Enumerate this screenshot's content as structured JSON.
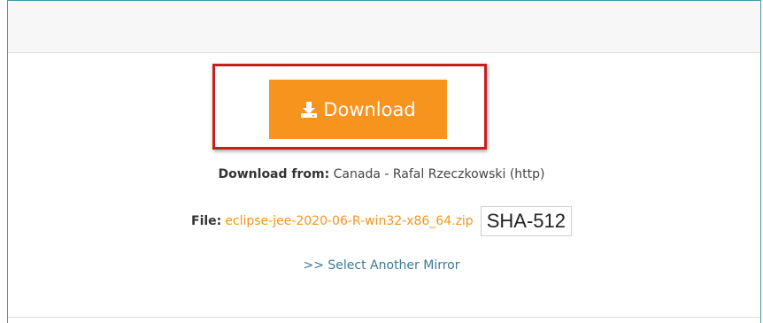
{
  "download_button": {
    "label": "Download",
    "icon": "download-icon",
    "color": "#f7941d"
  },
  "download_from": {
    "label": "Download from:",
    "value": "Canada - Rafal Rzeczkowski (http)"
  },
  "file": {
    "label": "File:",
    "name": "eclipse-jee-2020-06-R-win32-x86_64.zip",
    "checksum_label": "SHA-512"
  },
  "mirror_link": {
    "label": ">> Select Another Mirror"
  },
  "colors": {
    "accent": "#f7941d",
    "highlight": "#c81e1e",
    "link": "#3c7a9a",
    "border": "#3f9aa8"
  }
}
